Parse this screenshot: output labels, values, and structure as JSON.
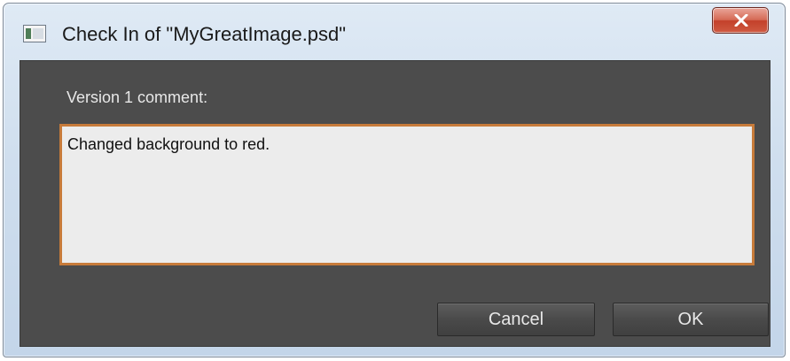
{
  "window": {
    "title": "Check In of \"MyGreatImage.psd\"",
    "close_icon": "close-icon",
    "app_icon": "app-icon"
  },
  "form": {
    "comment_label": "Version 1 comment:",
    "comment_value": "Changed background to red."
  },
  "buttons": {
    "cancel_label": "Cancel",
    "ok_label": "OK"
  },
  "colors": {
    "content_background": "#4c4c4c",
    "comment_border": "#c77b3a",
    "close_button": "#c3402a"
  }
}
